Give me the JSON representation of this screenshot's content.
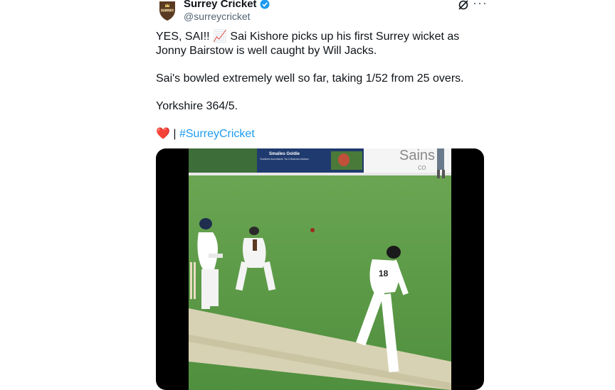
{
  "account": {
    "name": "Surrey Cricket",
    "handle": "@surreycricket",
    "avatar_text": "SURREY"
  },
  "tweet": {
    "line1": "YES, SAI!! 📈 Sai Kishore picks up his first Surrey wicket as Jonny Bairstow is well caught by Will Jacks.",
    "line2": "Sai's bowled extremely well so far, taking 1/52 from 25 overs.",
    "line3": "Yorkshire 364/5.",
    "heart": "❤️",
    "separator": " | ",
    "hashtag": "#SurreyCricket"
  },
  "video": {
    "billboard_brand": "Smailes Goldie",
    "billboard_tagline": "Chartered Accountants, Tax & Business Advisors",
    "billboard_right": "Sains",
    "billboard_right2": "co",
    "bowler_number": "18"
  },
  "colors": {
    "link": "#1d9bf0",
    "verified": "#1d9bf0",
    "pitch_green": "#5a9a45"
  },
  "icons": [
    "verified-badge-icon",
    "grok-icon",
    "more-options-icon"
  ]
}
